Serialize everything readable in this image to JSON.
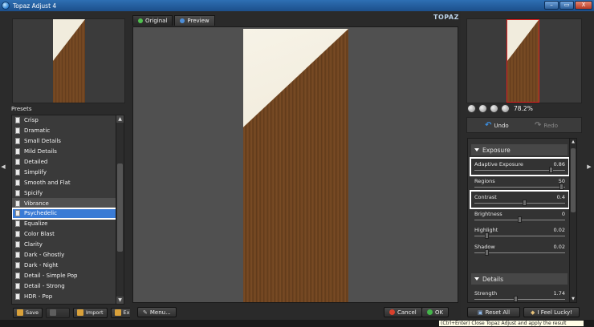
{
  "window": {
    "title": "Topaz Adjust 4",
    "buttons": [
      "–",
      "▭",
      "X"
    ]
  },
  "logo_text": "TOPAZ",
  "presets": {
    "label": "Presets",
    "items": [
      {
        "label": "Crisp"
      },
      {
        "label": "Dramatic"
      },
      {
        "label": "Small Details"
      },
      {
        "label": "Mild Details"
      },
      {
        "label": "Detailed"
      },
      {
        "label": "Simplify"
      },
      {
        "label": "Smooth and Flat"
      },
      {
        "label": "Spicify"
      },
      {
        "label": "Vibrance"
      },
      {
        "label": "Psychedelic"
      },
      {
        "label": "Equalize"
      },
      {
        "label": "Color Blast"
      },
      {
        "label": "Clarity"
      },
      {
        "label": "Dark - Ghostly"
      },
      {
        "label": "Dark - Night"
      },
      {
        "label": "Detail - Simple Pop"
      },
      {
        "label": "Detail - Strong"
      },
      {
        "label": "HDR - Pop"
      }
    ],
    "selected": "Psychedelic",
    "buttons": {
      "save": "Save",
      "delete": "",
      "import": "Import",
      "export": "Export"
    }
  },
  "tabs": {
    "original": "Original",
    "preview": "Preview"
  },
  "center_buttons": {
    "menu": "Menu...",
    "cancel": "Cancel",
    "ok": "OK"
  },
  "zoom": {
    "value": "78.2%"
  },
  "history": {
    "undo": "Undo",
    "redo": "Redo"
  },
  "exposure": {
    "title": "Exposure",
    "params": [
      {
        "name": "Adaptive Exposure",
        "value": "0.86",
        "level": 0.86
      },
      {
        "name": "Regions",
        "value": "50",
        "level": 0.98
      },
      {
        "name": "Contrast",
        "value": "0.4",
        "level": 0.56
      },
      {
        "name": "Brightness",
        "value": "0",
        "level": 0.5
      },
      {
        "name": "Highlight",
        "value": "0.02",
        "level": 0.12
      },
      {
        "name": "Shadow",
        "value": "0.02",
        "level": 0.12
      }
    ]
  },
  "details": {
    "title": "Details",
    "params": [
      {
        "name": "Strength",
        "value": "1.74",
        "level": 0.45
      }
    ]
  },
  "right_buttons": {
    "reset": "Reset All",
    "lucky": "I Feel Lucky!"
  },
  "hint_text": "(Ctrl+Enter) Close Topaz Adjust and apply the result"
}
